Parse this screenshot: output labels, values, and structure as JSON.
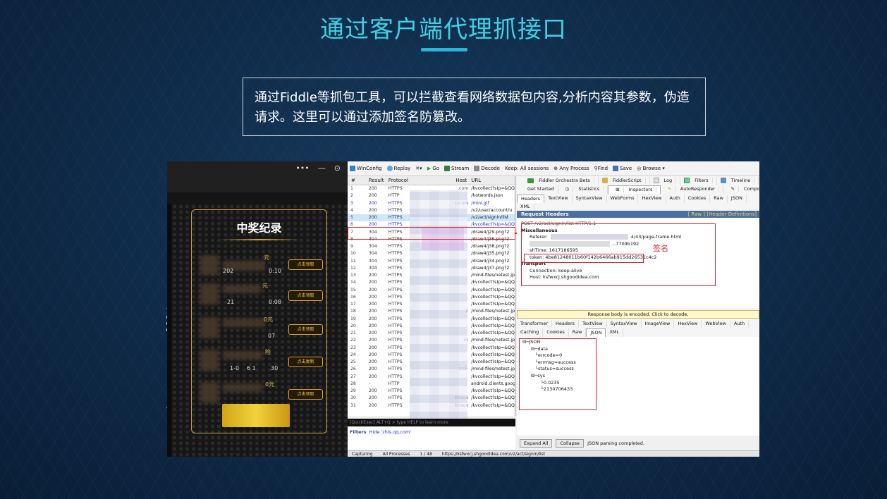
{
  "slide": {
    "title": "通过客户端代理抓接口",
    "description": "通过Fiddle等抓包工具，可以拦截查看网络数据包内容,分析内容其参数，伪造请求。这里可以通过添加签名防篡改。",
    "accent": "#3fd0e6"
  },
  "phone": {
    "page_title": "中奖纪录",
    "button_label": "点击领取",
    "button_label_copy": "点击复制",
    "fragments": [
      "元",
      "202",
      "0:10",
      "元",
      "21",
      "0:08",
      "0元",
      "07",
      "险",
      "1-0",
      "6 1",
      "30",
      "0元"
    ]
  },
  "fiddler": {
    "toolbar": [
      "WinConfig",
      "Replay",
      "Go",
      "Stream",
      "Decode",
      "Keep: All sessions",
      "Any Process",
      "Find",
      "Save",
      "Browse"
    ],
    "columns": [
      "#",
      "Result",
      "Protocol",
      "Host",
      "URL"
    ],
    "sessions": [
      {
        "n": "1",
        "result": "200",
        "protocol": "HTTPS",
        "host": ".com",
        "url": "/kvcollect?sIp=&QQ",
        "blue": false
      },
      {
        "n": "2",
        "result": "200",
        "protocol": "HTTP",
        "host": "",
        "url": "/hotwords.json",
        "blue": false
      },
      {
        "n": "3",
        "result": "200",
        "protocol": "HTTPS",
        "host": "u.com",
        "url": "/mini.gif",
        "blue": true
      },
      {
        "n": "4",
        "result": "200",
        "protocol": "HTTPS",
        "host": "",
        "url": "/v2/user/account/u",
        "blue": false
      },
      {
        "n": "5",
        "result": "200",
        "protocol": "HTTPS",
        "host": "",
        "url": "/v2/act/signin/list",
        "blue": false
      },
      {
        "n": "6",
        "result": "200",
        "protocol": "HTTPS",
        "host": "",
        "url": "/kvcollect?sIp=&QQ",
        "blue": true
      },
      {
        "n": "7",
        "result": "304",
        "protocol": "HTTPS",
        "host": "",
        "url": "/draw4/j29.png?2",
        "blue": false
      },
      {
        "n": "8",
        "result": "304",
        "protocol": "HTTPS",
        "host": "",
        "url": "/draw4/j36.png?2",
        "blue": false
      },
      {
        "n": "9",
        "result": "304",
        "protocol": "HTTPS",
        "host": "",
        "url": "/draw4/j38.png?2",
        "blue": false
      },
      {
        "n": "10",
        "result": "304",
        "protocol": "HTTPS",
        "host": "",
        "url": "/draw4/j35.png?2",
        "blue": false
      },
      {
        "n": "11",
        "result": "304",
        "protocol": "HTTPS",
        "host": "",
        "url": "/draw4/j34.png?2",
        "blue": false
      },
      {
        "n": "12",
        "result": "304",
        "protocol": "HTTPS",
        "host": "",
        "url": "/draw4/j37.png?2",
        "blue": false
      },
      {
        "n": "13",
        "result": "200",
        "protocol": "HTTPS",
        "host": "",
        "url": "/mind-files/netest.jpe",
        "blue": false
      },
      {
        "n": "14",
        "result": "200",
        "protocol": "HTTPS",
        "host": "",
        "url": "/kvcollect?sIp=&QQ",
        "blue": false
      },
      {
        "n": "15",
        "result": "200",
        "protocol": "HTTPS",
        "host": "",
        "url": "/kvcollect?sIp=&QQ",
        "blue": false
      },
      {
        "n": "16",
        "result": "200",
        "protocol": "HTTPS",
        "host": "",
        "url": "/kvcollect?sIp=&QQ",
        "blue": false
      },
      {
        "n": "17",
        "result": "200",
        "protocol": "HTTPS",
        "host": "",
        "url": "/kvcollect?sIp=&QQ",
        "blue": false
      },
      {
        "n": "18",
        "result": "200",
        "protocol": "HTTPS",
        "host": "k",
        "url": "/mind-files/netest.jp",
        "blue": false
      },
      {
        "n": "19",
        "result": "200",
        "protocol": "HTTPS",
        "host": "",
        "url": "/kvcollect?sIp=&QQ",
        "blue": false
      },
      {
        "n": "20",
        "result": "200",
        "protocol": "HTTPS",
        "host": "",
        "url": "/kvcollect?sIp=&QQ",
        "blue": false
      },
      {
        "n": "21",
        "result": "200",
        "protocol": "HTTPS",
        "host": "",
        "url": "/kvcollect?sIp=&QQ",
        "blue": false
      },
      {
        "n": "22",
        "result": "200",
        "protocol": "HTTPS",
        "host": "ks",
        "url": "/mind-files/netest.jp",
        "blue": false
      },
      {
        "n": "23",
        "result": "200",
        "protocol": "HTTPS",
        "host": "",
        "url": "/kvcollect?sIp=&QQ",
        "blue": false
      },
      {
        "n": "24",
        "result": "200",
        "protocol": "HTTPS",
        "host": "",
        "url": "/kvcollect?sIp=&QQ",
        "blue": false
      },
      {
        "n": "25",
        "result": "200",
        "protocol": "HTTPS",
        "host": "",
        "url": "/kvcollect?sIp=&QQ",
        "blue": false
      },
      {
        "n": "26",
        "result": "200",
        "protocol": "HTTPS",
        "host": "ks3-",
        "url": "/mind-files/netest.jp",
        "blue": false
      },
      {
        "n": "27",
        "result": "200",
        "protocol": "HTTPS",
        "host": "",
        "url": "/kvcollect?sIp=&QQ",
        "blue": false
      },
      {
        "n": "28",
        "result": "-",
        "protocol": "HTTP",
        "host": "",
        "url": "android.clients.goog",
        "blue": false
      },
      {
        "n": "29",
        "result": "200",
        "protocol": "HTTPS",
        "host": "",
        "url": "/kvcollect?sIp=&QQ",
        "blue": false
      },
      {
        "n": "30",
        "result": "200",
        "protocol": "HTTPS",
        "host": "btrace",
        "url": "/kvcollect?sIp=&QQ",
        "blue": false
      },
      {
        "n": "31",
        "result": "200",
        "protocol": "HTTPS",
        "host": "btrace",
        "url": "/kvcollect?sIp=&QQ",
        "blue": false
      }
    ],
    "quickexec": "[QuickExec] ALT+Q > type HELP to learn more",
    "filters_label": "Filters",
    "filters_value": "Hide 'zhls.qq.com'",
    "tabs_row1": [
      "Fiddler Orchestra Beta",
      "FiddlerScript",
      "Log",
      "Filters",
      "Timeline"
    ],
    "tabs_row2": [
      "Get Started",
      "Statistics",
      "Inspectors",
      "AutoResponder",
      "Composer"
    ],
    "req_tabs": [
      "Headers",
      "TextView",
      "SyntaxView",
      "WebForms",
      "HexView",
      "Auth",
      "Cookies",
      "Raw",
      "JSON"
    ],
    "req_tab_xml": "XML",
    "req_title": "Request Headers",
    "req_links": "[ Raw ]  [Header Definitions]",
    "req_line": "POST /v2/act/signin/list HTTP/1.1",
    "misc": "Miscellaneous",
    "referer_label": "Referer:",
    "referer_value": "4/43/page-frame.html",
    "sign_value": "...7709b192",
    "shtime": "shTime: 1617186595",
    "token": "token: 4be81248011b60f142b6466ab915dd26531c4c2",
    "transport": "Transport",
    "connection": "Connection: keep-alive",
    "host_header": "Host: ksfwxcj.shgoodidea.com",
    "sign_label": "签名",
    "encoded": "Response body is encoded. Click to decode.",
    "resp_tabs1": [
      "Transformer",
      "Headers",
      "TextView",
      "SyntaxView",
      "ImageView",
      "HexView",
      "WebView",
      "Auth"
    ],
    "resp_tabs2": [
      "Caching",
      "Cookies",
      "Raw",
      "JSON",
      "XML"
    ],
    "tree": [
      "JSON",
      "data",
      "errcode=0",
      "errmsg=success",
      "status=success",
      "sys",
      "0.0235",
      "2130706433"
    ],
    "expand_all": "Expand All",
    "collapse": "Collapse",
    "json_status": "JSON parsing completed.",
    "status_capturing": "Capturing",
    "status_processes": "All Processes",
    "status_count": "1 / 48",
    "status_url": "https://ksfwxcj.shgoodidea.com/v2/act/signin/list"
  },
  "colors": {
    "red": "#e0202a",
    "gold": "#d9a826",
    "fiddler_blue": "#1d2be0"
  }
}
